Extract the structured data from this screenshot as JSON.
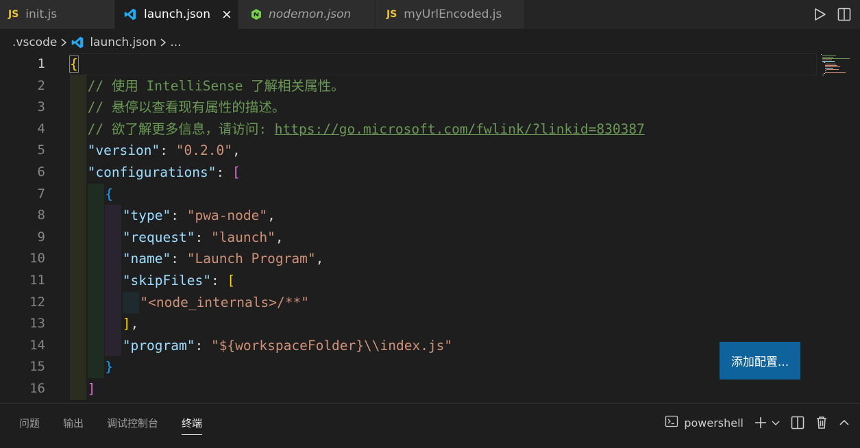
{
  "tabs": [
    {
      "label": "init.js",
      "icon": "javascript-icon",
      "badge": "JS",
      "italic": false,
      "active": false
    },
    {
      "label": "launch.json",
      "icon": "vscode-icon",
      "italic": false,
      "active": true,
      "close": "×"
    },
    {
      "label": "nodemon.json",
      "icon": "nodemon-icon",
      "italic": true,
      "active": false
    },
    {
      "label": "myUrlEncoded.js",
      "icon": "javascript-icon",
      "badge": "JS",
      "italic": false,
      "active": false
    }
  ],
  "breadcrumb": {
    "folder": ".vscode",
    "file": "launch.json",
    "more": "..."
  },
  "editor": {
    "line_numbers": [
      "1",
      "2",
      "3",
      "4",
      "5",
      "6",
      "7",
      "8",
      "9",
      "10",
      "11",
      "12",
      "13",
      "14",
      "15",
      "16"
    ],
    "current_line": 1,
    "lines": [
      [
        {
          "t": "{",
          "c": "c-br1"
        }
      ],
      [
        {
          "t": "// 使用 IntelliSense 了解相关属性。",
          "c": "c-com"
        }
      ],
      [
        {
          "t": "// 悬停以查看现有属性的描述。",
          "c": "c-com"
        }
      ],
      [
        {
          "t": "// 欲了解更多信息，请访问: ",
          "c": "c-com"
        },
        {
          "t": "https://go.microsoft.com/fwlink/?linkid=830387",
          "c": "c-link"
        }
      ],
      [
        {
          "t": "\"version\"",
          "c": "c-key"
        },
        {
          "t": ": ",
          "c": "c-pun"
        },
        {
          "t": "\"0.2.0\"",
          "c": "c-str"
        },
        {
          "t": ",",
          "c": "c-pun"
        }
      ],
      [
        {
          "t": "\"configurations\"",
          "c": "c-key"
        },
        {
          "t": ": ",
          "c": "c-pun"
        },
        {
          "t": "[",
          "c": "c-br2"
        }
      ],
      [
        {
          "t": "{",
          "c": "c-br3"
        }
      ],
      [
        {
          "t": "\"type\"",
          "c": "c-key"
        },
        {
          "t": ": ",
          "c": "c-pun"
        },
        {
          "t": "\"pwa-node\"",
          "c": "c-str"
        },
        {
          "t": ",",
          "c": "c-pun"
        }
      ],
      [
        {
          "t": "\"request\"",
          "c": "c-key"
        },
        {
          "t": ": ",
          "c": "c-pun"
        },
        {
          "t": "\"launch\"",
          "c": "c-str"
        },
        {
          "t": ",",
          "c": "c-pun"
        }
      ],
      [
        {
          "t": "\"name\"",
          "c": "c-key"
        },
        {
          "t": ": ",
          "c": "c-pun"
        },
        {
          "t": "\"Launch Program\"",
          "c": "c-str"
        },
        {
          "t": ",",
          "c": "c-pun"
        }
      ],
      [
        {
          "t": "\"skipFiles\"",
          "c": "c-key"
        },
        {
          "t": ": ",
          "c": "c-pun"
        },
        {
          "t": "[",
          "c": "c-br1"
        }
      ],
      [
        {
          "t": "\"<node_internals>/**\"",
          "c": "c-str"
        }
      ],
      [
        {
          "t": "]",
          "c": "c-br1"
        },
        {
          "t": ",",
          "c": "c-pun"
        }
      ],
      [
        {
          "t": "\"program\"",
          "c": "c-key"
        },
        {
          "t": ": ",
          "c": "c-pun"
        },
        {
          "t": "\"${workspaceFolder}\\\\index.js\"",
          "c": "c-str"
        }
      ],
      [
        {
          "t": "}",
          "c": "c-br3"
        }
      ],
      [
        {
          "t": "]",
          "c": "c-br2"
        }
      ]
    ]
  },
  "add_config_button": "添加配置...",
  "panel": {
    "tabs": [
      {
        "label": "问题",
        "active": false
      },
      {
        "label": "输出",
        "active": false
      },
      {
        "label": "调试控制台",
        "active": false
      },
      {
        "label": "终端",
        "active": true
      }
    ],
    "terminal_name": "powershell"
  },
  "colors": {
    "accent": "#0e639c",
    "js": "#e8c33a",
    "vscode_blue": "#23a9f2",
    "nodemon_green": "#76d04b"
  }
}
